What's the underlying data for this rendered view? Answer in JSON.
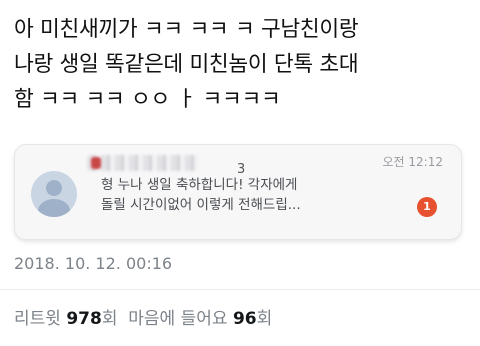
{
  "tweet": {
    "lines": [
      "아 미친새끼가 ㅋㅋ ㅋㅋ ㅋ 구남친이랑",
      "나랑 생일 똑같은데 미친놈이 단톡 초대",
      "함 ㅋㅋ ㅋㅋ ㅇㅇ ㅏ ㅋㅋㅋㅋ"
    ]
  },
  "notification": {
    "sender_visible": "3",
    "time": "오전 12:12",
    "preview_lines": [
      "형 누나 생일 축하합니다! 각자에게",
      "돌릴 시간이없어 이렇게 전해드립..."
    ],
    "unread_count": "1",
    "avatar_icon": "default-profile-icon",
    "badge_color": "#e8512f"
  },
  "meta": {
    "timestamp": "2018. 10. 12. 00:16"
  },
  "stats": {
    "retweet_label": "리트윗",
    "retweet_count": "978",
    "retweet_unit": "회",
    "like_label": "마음에 들어요",
    "like_count": "96",
    "like_unit": "회"
  }
}
